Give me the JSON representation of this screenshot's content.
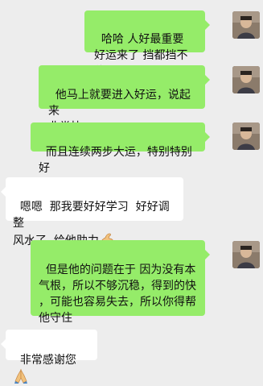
{
  "messages": [
    {
      "sender": "me",
      "text": "哈哈 人好最重要\n好运来了 挡都挡不住"
    },
    {
      "sender": "me",
      "text": "他马上就要进入好运，说起来\n非常快"
    },
    {
      "sender": "me",
      "text": "而且连续两步大运，特别特别好"
    },
    {
      "sender": "other",
      "text": "嗯嗯  那我要好好学习  好好调整\n风水了  给他助力",
      "emoji": "flexed-biceps-icon"
    },
    {
      "sender": "me",
      "text": "但是他的问题在于 因为没有本\n气根，所以不够沉稳，得到的快\n，可能也容易失去，所以你得帮\n他守住"
    },
    {
      "sender": "other",
      "text": "非常感谢您",
      "emoji": "folded-hands-icon"
    }
  ],
  "colors": {
    "background": "#ededed",
    "my_bubble": "#95ec69",
    "other_bubble": "#ffffff"
  }
}
